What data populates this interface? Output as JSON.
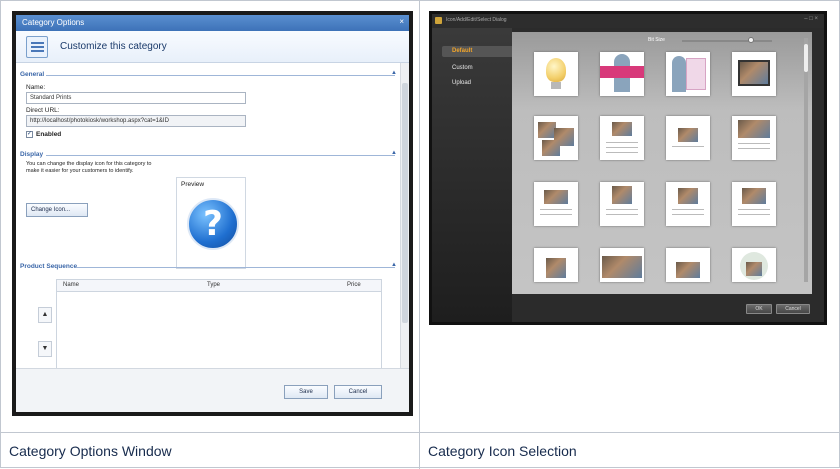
{
  "window1": {
    "title": "Category Options",
    "close_glyph": "×",
    "header_title": "Customize this category",
    "header_icon": "list-icon",
    "general": {
      "section_label": "General",
      "name_label": "Name:",
      "name_value": "Standard Prints",
      "direct_url_label": "Direct URL:",
      "direct_url_value": "http://localhost/photokiosk/workshop.aspx?cat=1&ID",
      "enabled_label": "Enabled",
      "enabled_checked": true
    },
    "display": {
      "section_label": "Display",
      "help_text": "You can change the display icon for this category to make it easier for your customers to identify.",
      "change_icon_button": "Change Icon...",
      "preview_label": "Preview",
      "preview_icon": "question-mark-icon"
    },
    "product_sequence": {
      "section_label": "Product Sequence",
      "columns": [
        "Name",
        "Type",
        "Price"
      ],
      "up_glyph": "▲",
      "down_glyph": "▼"
    },
    "footer": {
      "save_button": "Save",
      "cancel_button": "Cancel"
    }
  },
  "window2": {
    "title": "Icon/Add/Edit/Select Dialog",
    "controls": "–  □  ×",
    "sidebar": [
      "Default",
      "Custom",
      "Upload"
    ],
    "active_sidebar": "Default",
    "zoom_label": "Bit Size",
    "buttons": {
      "ok": "OK",
      "cancel": "Cancel"
    }
  },
  "captions": {
    "left": "Category Options Window",
    "right": "Category Icon Selection"
  },
  "colors": {
    "title_blue": "#3d72b8",
    "accent_orange": "#f2a52a",
    "icon_blue": "#1f6fd0"
  }
}
